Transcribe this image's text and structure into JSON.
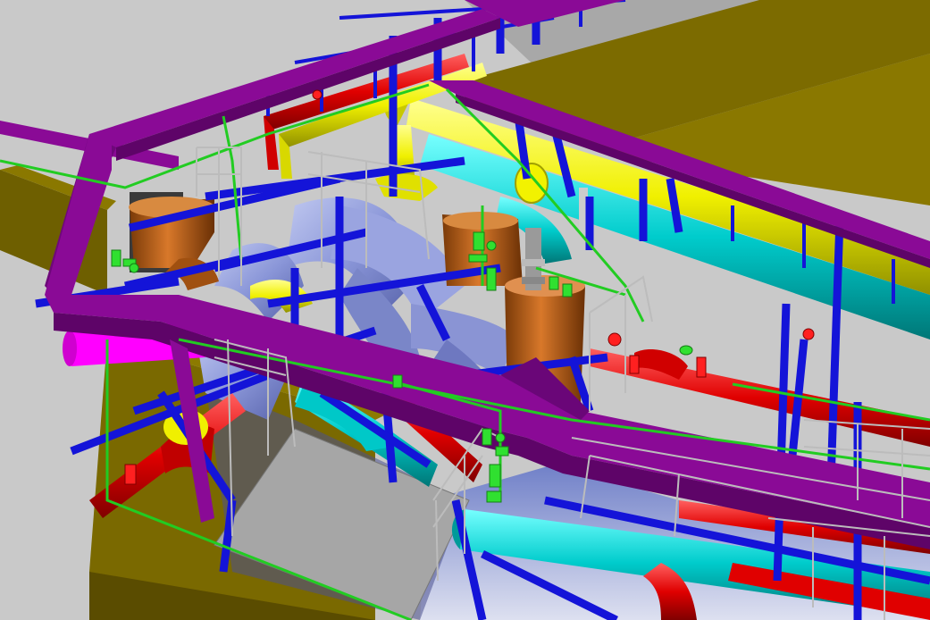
{
  "scene": {
    "background": "#c9c9c9",
    "colors": {
      "slab_top": "#7c6b00",
      "slab_side": "#5d5000",
      "slab_dark": "#4a3f00",
      "purple_duct": "#8a0a96",
      "purple_side": "#5e0468",
      "red_pipe": "#e20000",
      "yellow_pipe": "#f2f200",
      "cyan_pipe": "#00d8d8",
      "blue_beam": "#1010d8",
      "green_pipe": "#22cc22",
      "orange_vessel": "#c86a1e",
      "magenta_pipe": "#ff00ff",
      "steel_duct": "#8a96d8",
      "grey_plate": "#a0a0a0",
      "handrail": "#b8b8b8",
      "valve_green": "#30e030"
    }
  }
}
